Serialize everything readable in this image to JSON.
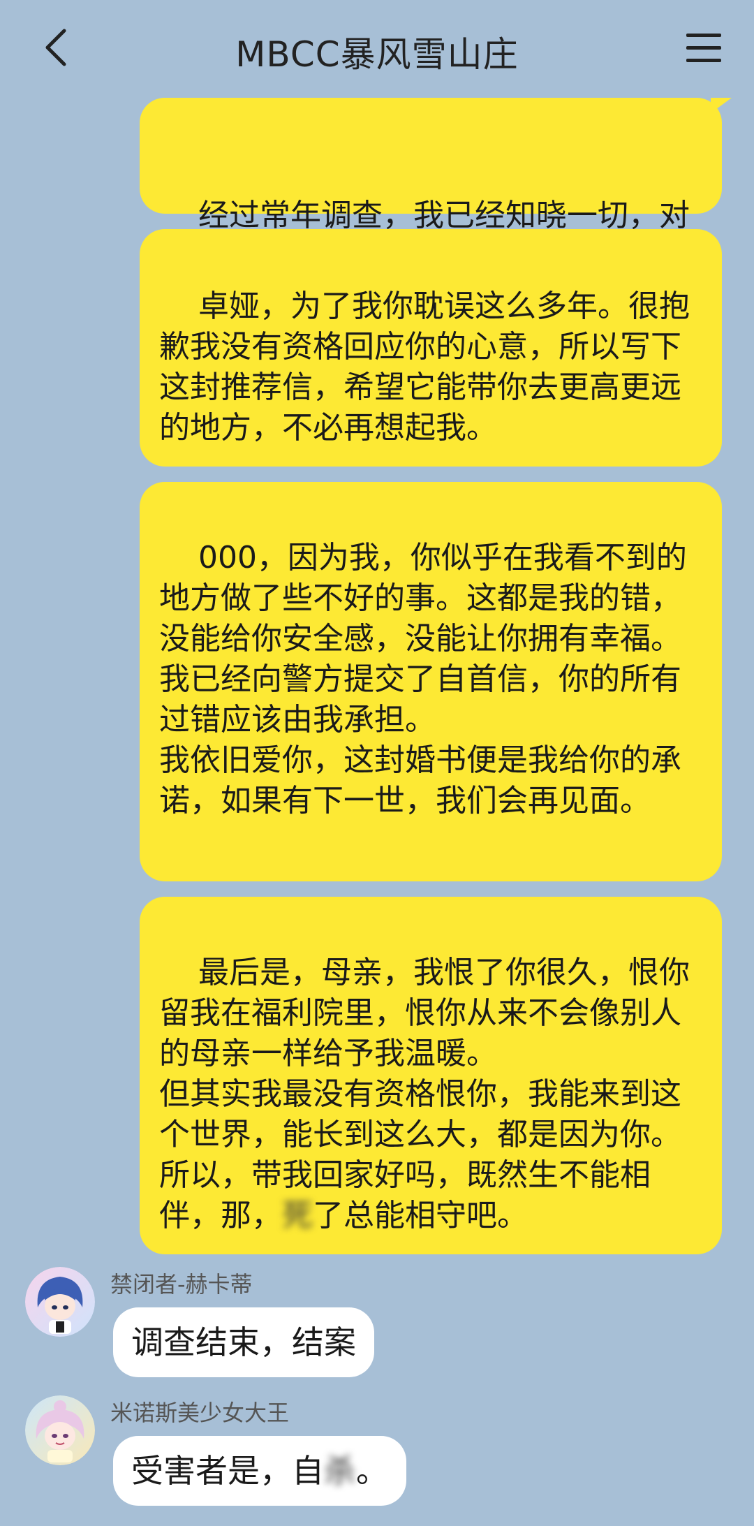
{
  "header": {
    "title": "MBCC暴风雪山庄",
    "back_icon": "chevron-left-icon",
    "menu_icon": "hamburger-menu-icon"
  },
  "outgoing_messages": [
    "经过常年调查，我已经知晓一切，对于如今的所有混乱，十分抱歉",
    "卓娅，为了我你耽误这么多年。很抱歉我没有资格回应你的心意，所以写下这封推荐信，希望它能带你去更高更远的地方，不必再想起我。",
    "000，因为我，你似乎在我看不到的地方做了些不好的事。这都是我的错，没能给你安全感，没能让你拥有幸福。\n我已经向警方提交了自首信，你的所有过错应该由我承担。\n我依旧爱你，这封婚书便是我给你的承诺，如果有下一世，我们会再见面。",
    "最后是，母亲，我恨了你很久，恨你留我在福利院里，恨你从来不会像别人的母亲一样给予我温暖。\n但其实我最没有资格恨你，我能来到这个世界，能长到这么大，都是因为你。\n所以，带我回家好吗，既然生不能相伴，那，"
  ],
  "outgoing_4_blurred": "死",
  "outgoing_4_tail": "了总能相守吧。",
  "incoming_messages": [
    {
      "sender": "禁闭者-赫卡蒂",
      "text": "调查结束，结案",
      "avatar": "avatar-blue-hair-character"
    },
    {
      "sender": "米诺斯美少女大王",
      "text_before": "受害者是，自",
      "text_blurred": "杀",
      "text_after": "。",
      "avatar": "avatar-pink-hair-character"
    }
  ],
  "colors": {
    "background": "#a7bfd6",
    "outgoing_bubble": "#fde934",
    "incoming_bubble": "#ffffff"
  }
}
